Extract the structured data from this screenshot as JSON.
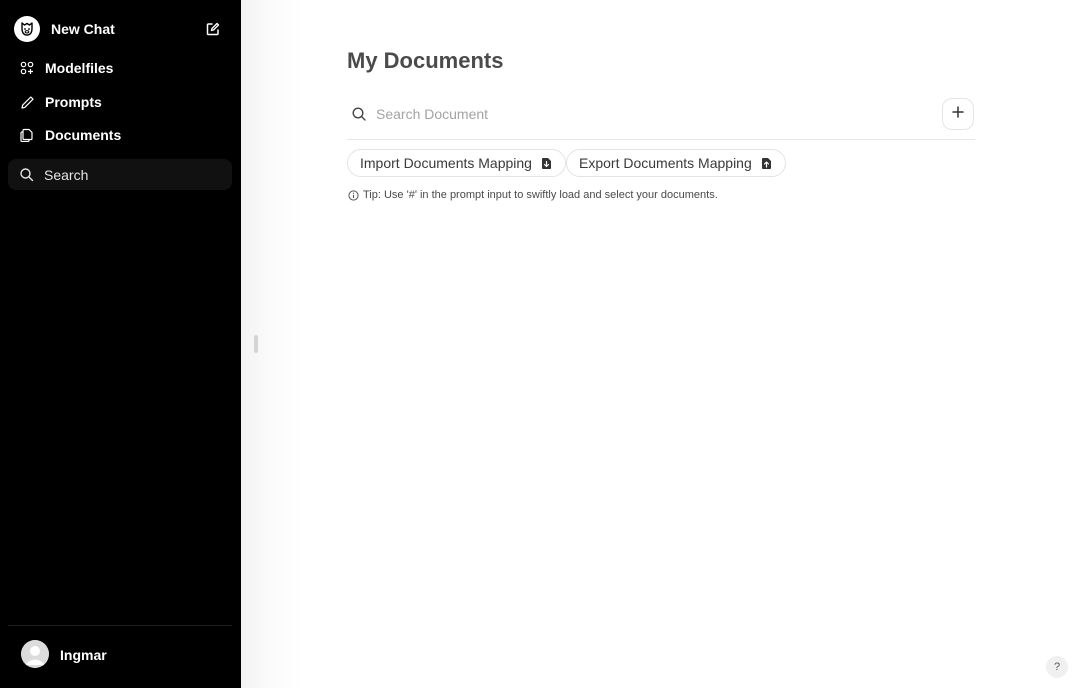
{
  "sidebar": {
    "new_chat_label": "New Chat",
    "nav_items": [
      {
        "label": "Modelfiles",
        "icon": "modelfiles-icon"
      },
      {
        "label": "Prompts",
        "icon": "pencil-icon"
      },
      {
        "label": "Documents",
        "icon": "documents-icon"
      }
    ],
    "search_label": "Search",
    "user_name": "Ingmar"
  },
  "main": {
    "title": "My Documents",
    "search_placeholder": "Search Document",
    "import_label": "Import Documents Mapping",
    "export_label": "Export Documents Mapping",
    "tip": "Tip: Use '#' in the prompt input to swiftly load and select your documents.",
    "help_label": "?"
  },
  "colors": {
    "sidebar_bg": "#000000",
    "title": "#4b4b4b",
    "border": "#e5e5e5"
  }
}
